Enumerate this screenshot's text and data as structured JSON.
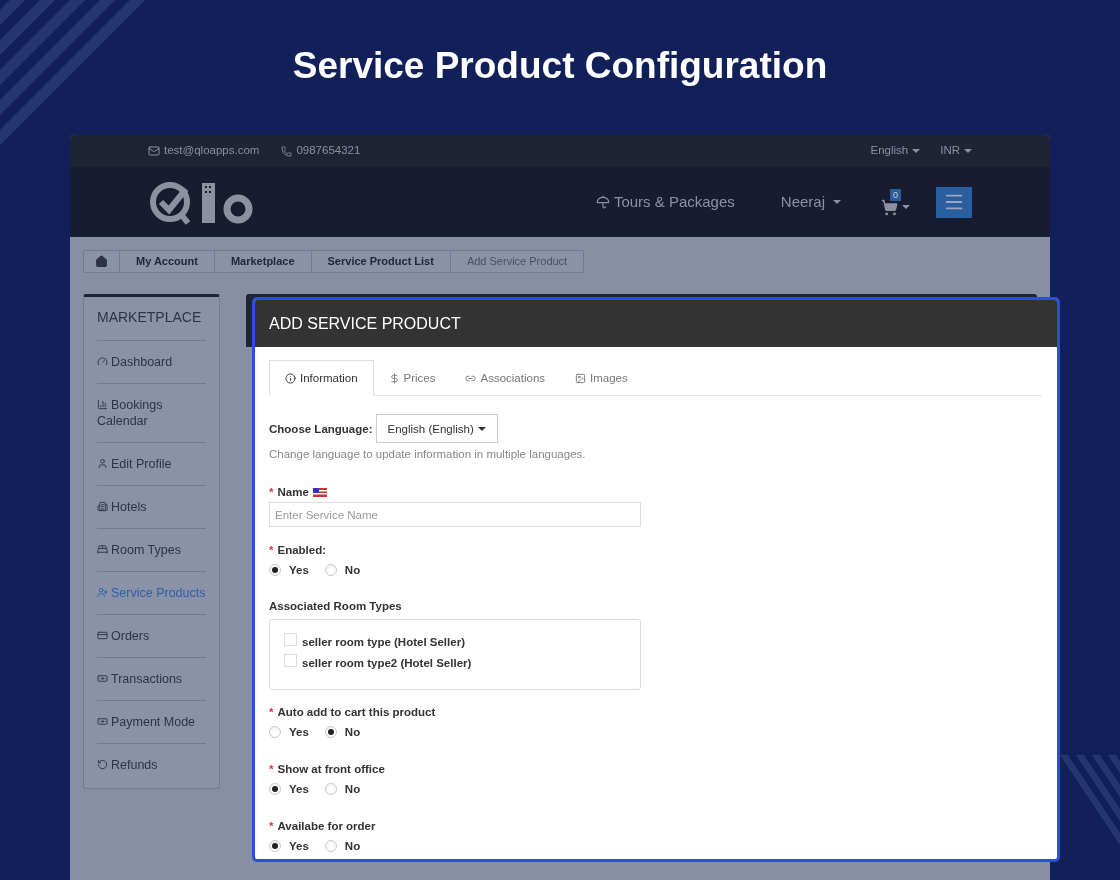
{
  "headline": "Service Product Configuration",
  "topbar": {
    "email": "test@qloapps.com",
    "phone": "0987654321",
    "language": "English",
    "currency": "INR"
  },
  "nav": {
    "links": [
      "Tours & Packages"
    ],
    "user": "Neeraj",
    "cart_count": "0"
  },
  "breadcrumb": [
    "My Account",
    "Marketplace",
    "Service Product List",
    "Add Service Product"
  ],
  "sidebar": {
    "title": "MARKETPLACE",
    "items": [
      {
        "kind": "dashboard",
        "label": "Dashboard",
        "selected": false
      },
      {
        "kind": "calendar",
        "label": "Bookings Calendar",
        "selected": false
      },
      {
        "kind": "profile",
        "label": "Edit Profile",
        "selected": false
      },
      {
        "kind": "hotels",
        "label": "Hotels",
        "selected": false
      },
      {
        "kind": "rooms",
        "label": "Room Types",
        "selected": false
      },
      {
        "kind": "services",
        "label": "Service Products",
        "selected": true
      },
      {
        "kind": "orders",
        "label": "Orders",
        "selected": false
      },
      {
        "kind": "transactions",
        "label": "Transactions",
        "selected": false
      },
      {
        "kind": "payment",
        "label": "Payment Mode",
        "selected": false
      },
      {
        "kind": "refunds",
        "label": "Refunds",
        "selected": false
      }
    ]
  },
  "panel": {
    "title": "ADD SERVICE PRODUCT",
    "tabs": [
      {
        "kind": "info",
        "label": "Information",
        "selected": true
      },
      {
        "kind": "prices",
        "label": "Prices",
        "selected": false
      },
      {
        "kind": "associations",
        "label": "Associations",
        "selected": false
      },
      {
        "kind": "images",
        "label": "Images",
        "selected": false
      }
    ],
    "language": {
      "label": "Choose Language:",
      "value": "English (English)",
      "help": "Change language to update information in multiple languages."
    },
    "name": {
      "label": "Name",
      "required_mark": "*",
      "placeholder": "Enter Service Name"
    },
    "enabled": {
      "label": "Enabled:",
      "required_mark": "*",
      "options": [
        {
          "label": "Yes",
          "selected": true
        },
        {
          "label": "No",
          "selected": false
        }
      ]
    },
    "room_types": {
      "label": "Associated Room Types",
      "items": [
        {
          "label": "seller room type (Hotel Seller)",
          "checked": false
        },
        {
          "label": "seller room type2 (Hotel Seller)",
          "checked": false
        }
      ]
    },
    "radio_groups": [
      {
        "label": "Auto add to cart this product",
        "required_mark": "*",
        "options": [
          {
            "label": "Yes",
            "selected": false
          },
          {
            "label": "No",
            "selected": true
          }
        ]
      },
      {
        "label": "Show at front office",
        "required_mark": "*",
        "options": [
          {
            "label": "Yes",
            "selected": true
          },
          {
            "label": "No",
            "selected": false
          }
        ]
      },
      {
        "label": "Availabe for order",
        "required_mark": "*",
        "options": [
          {
            "label": "Yes",
            "selected": true
          },
          {
            "label": "No",
            "selected": false
          }
        ]
      }
    ]
  }
}
